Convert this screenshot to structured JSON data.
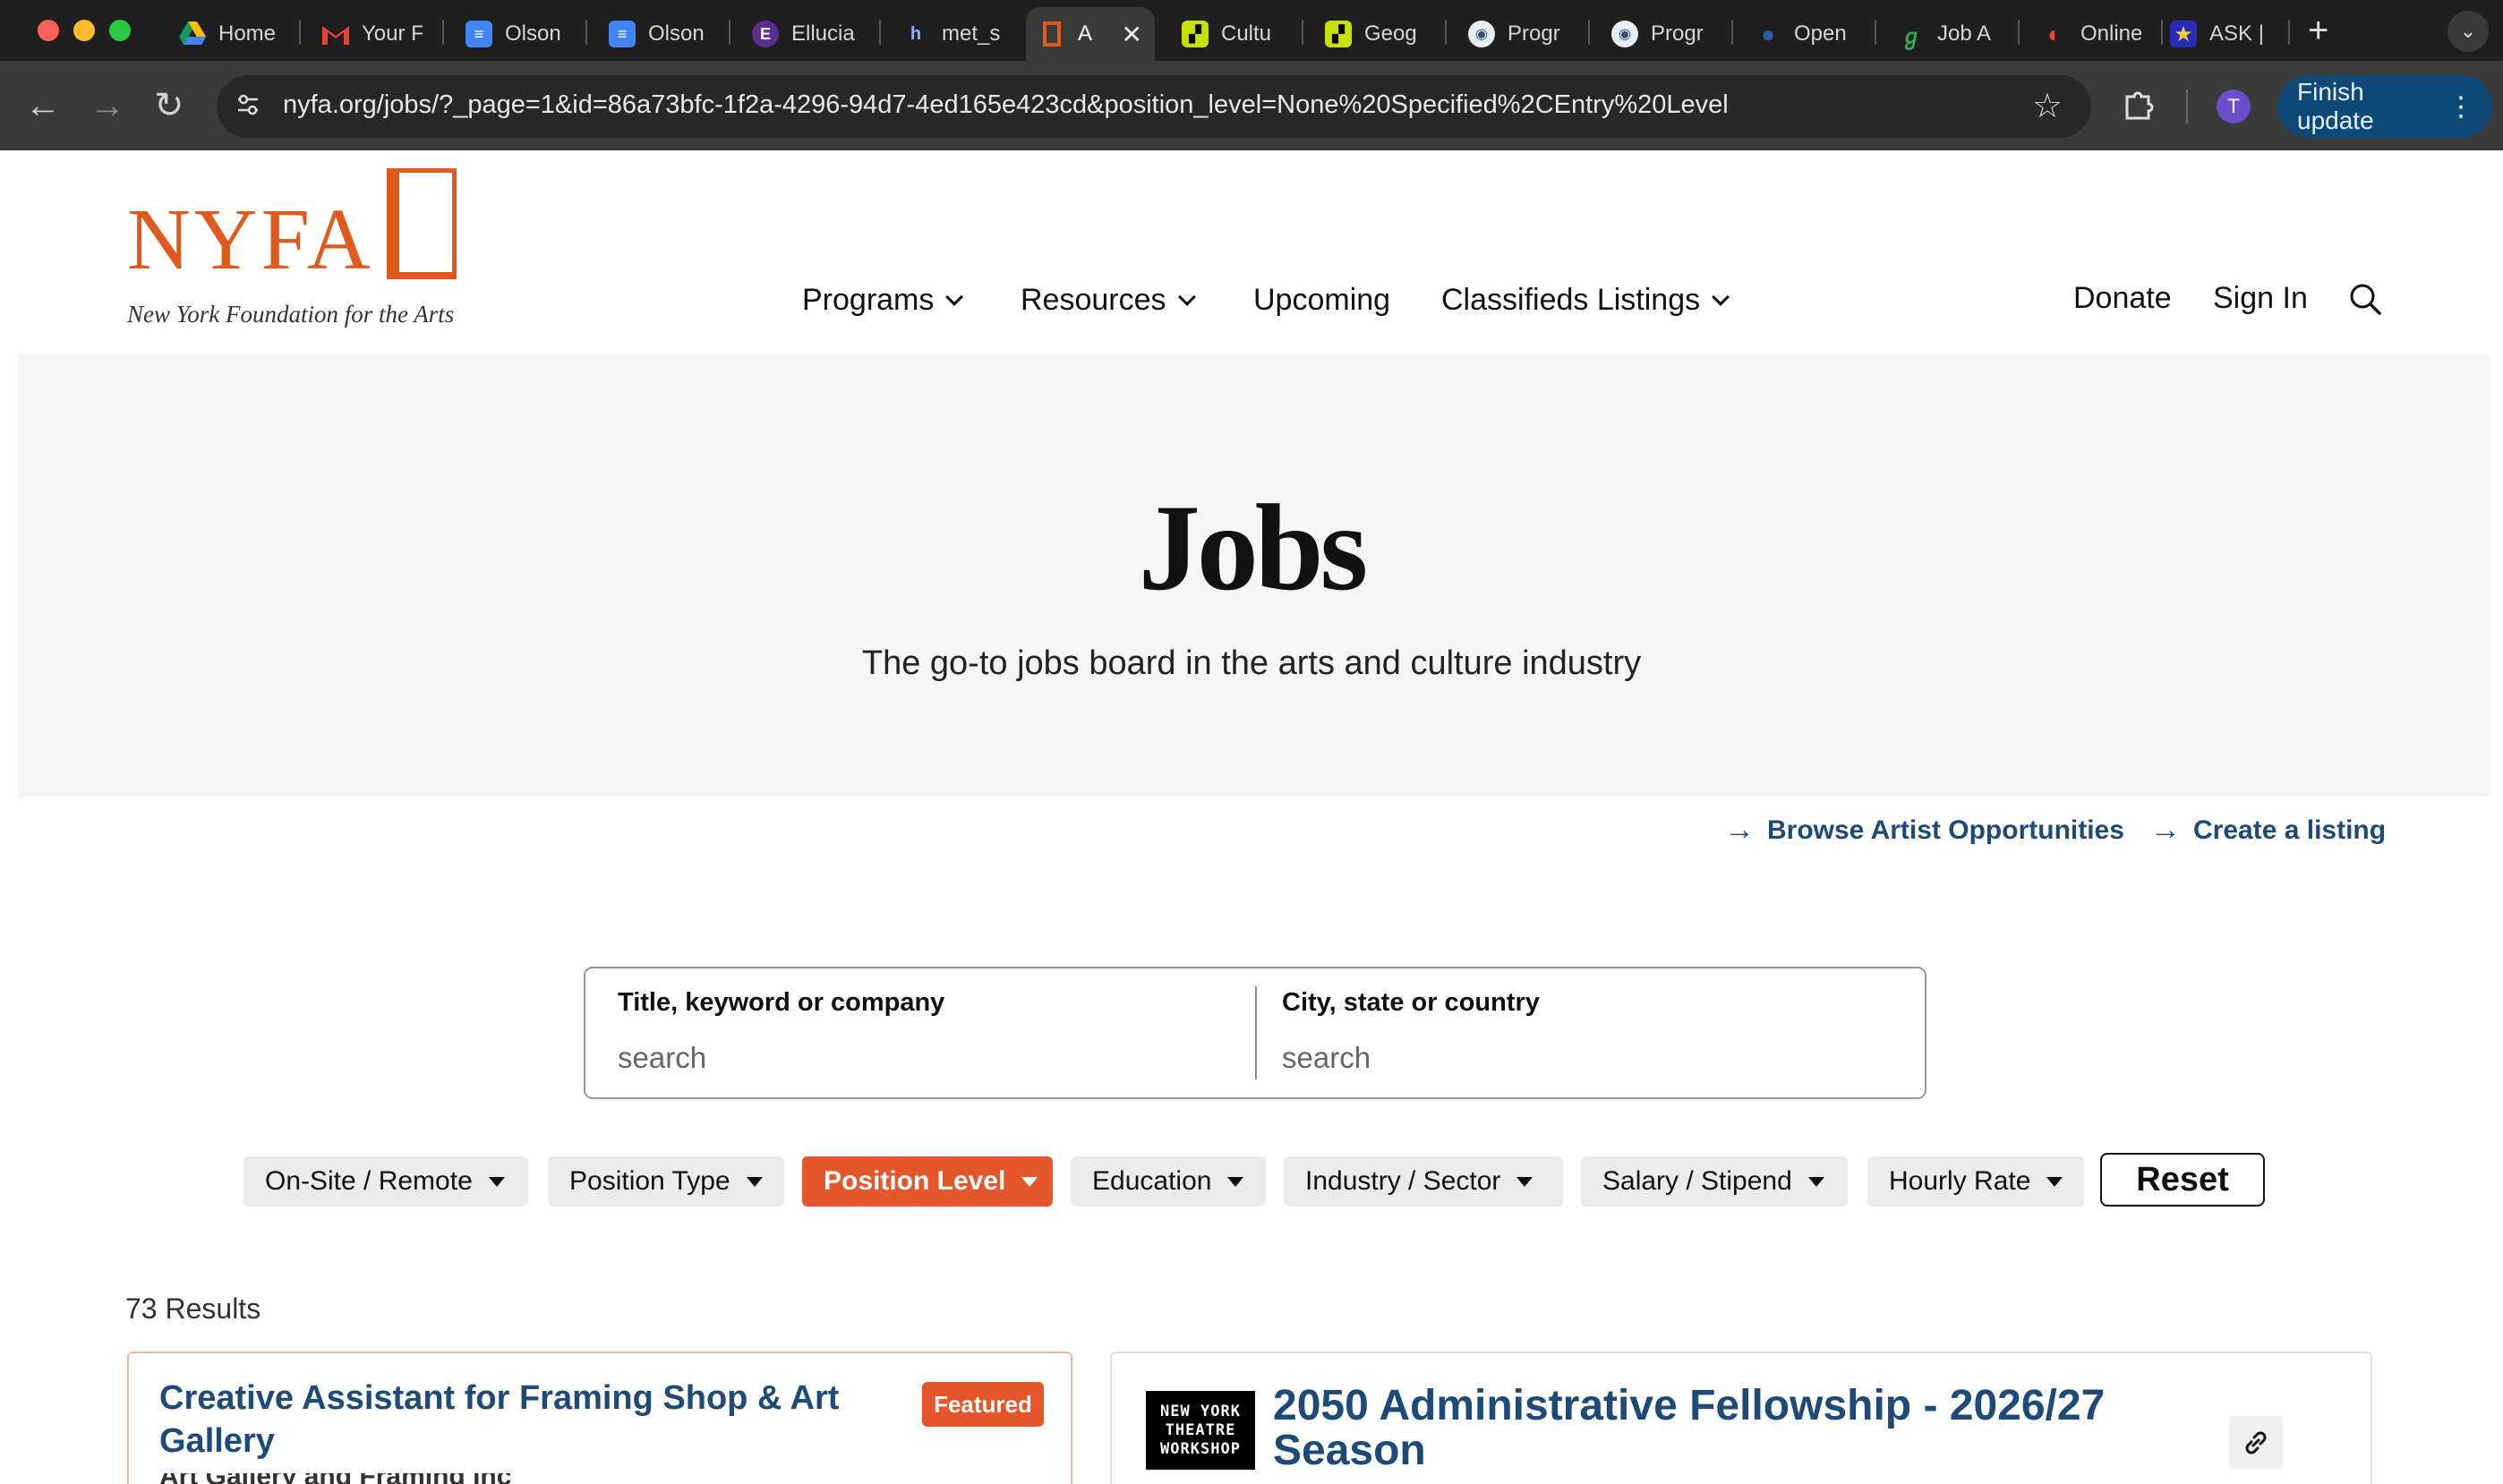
{
  "browser": {
    "tabs": [
      {
        "label": "Home",
        "icon": "google-drive-icon",
        "color": "#34a853",
        "active": false
      },
      {
        "label": "Your F",
        "icon": "gmail-icon",
        "color": "#ea4335",
        "active": false
      },
      {
        "label": "Olson",
        "icon": "google-docs-icon",
        "color": "#4285f4",
        "active": false
      },
      {
        "label": "Olson",
        "icon": "google-docs-icon",
        "color": "#4285f4",
        "active": false
      },
      {
        "label": "Ellucia",
        "icon": "ellucian-icon",
        "color": "#5b2d90",
        "active": false
      },
      {
        "label": "met_s",
        "icon": "h-icon",
        "color": "#1f1f1f",
        "active": false
      },
      {
        "label": "A",
        "icon": "nyfa-icon",
        "color": "#e05a1e",
        "active": true
      },
      {
        "label": "Cultu",
        "icon": "culture-icon",
        "color": "#c8e000",
        "active": false
      },
      {
        "label": "Geog",
        "icon": "geography-icon",
        "color": "#c8e000",
        "active": false
      },
      {
        "label": "Progr",
        "icon": "program-icon",
        "color": "#7a8ca8",
        "active": false
      },
      {
        "label": "Progr",
        "icon": "program-icon",
        "color": "#7a8ca8",
        "active": false
      },
      {
        "label": "Open",
        "icon": "open-icon",
        "color": "#2b5ea7",
        "active": false
      },
      {
        "label": "Job A",
        "icon": "job-icon",
        "color": "#34a853",
        "active": false
      },
      {
        "label": "Online",
        "icon": "online-icon",
        "color": "#e04e2c",
        "active": false
      },
      {
        "label": "ASK |",
        "icon": "star-icon",
        "color": "#f4d03f",
        "active": false
      }
    ],
    "new_tab": "+",
    "url": "nyfa.org/jobs/?_page=1&id=86a73bfc-1f2a-4296-94d7-4ed165e423cd&position_level=None%20Specified%2CEntry%20Level",
    "profile_initial": "T",
    "update_label": "Finish update"
  },
  "site": {
    "logo_text": "NYFA",
    "logo_tagline": "New York Foundation for the Arts",
    "nav": [
      {
        "label": "Programs",
        "dropdown": true
      },
      {
        "label": "Resources",
        "dropdown": true
      },
      {
        "label": "Upcoming",
        "dropdown": false
      },
      {
        "label": "Classifieds Listings",
        "dropdown": true
      }
    ],
    "donate": "Donate",
    "sign_in": "Sign In",
    "accent": "#e05a1e",
    "link_color": "#1e4a78"
  },
  "hero": {
    "title": "Jobs",
    "subtitle": "The go-to jobs board in the arts and culture industry"
  },
  "links": {
    "browse": "Browse Artist Opportunities",
    "create": "Create a listing"
  },
  "search": {
    "keyword_label": "Title, keyword or company",
    "keyword_placeholder": "search",
    "location_label": "City, state or country",
    "location_placeholder": "search"
  },
  "filters": [
    {
      "label": "On-Site / Remote",
      "active": false
    },
    {
      "label": "Position Type",
      "active": false
    },
    {
      "label": "Position Level",
      "active": true
    },
    {
      "label": "Education",
      "active": false
    },
    {
      "label": "Industry / Sector",
      "active": false
    },
    {
      "label": "Salary / Stipend",
      "active": false
    },
    {
      "label": "Hourly Rate",
      "active": false
    }
  ],
  "reset_label": "Reset",
  "results": {
    "count": "73 Results",
    "cards": [
      {
        "title_line1": "Creative Assistant for Framing Shop & Art",
        "title_line2": "Gallery",
        "badge": "Featured",
        "subtitle_partial": "Art Gallery and Framing Inc"
      },
      {
        "title_line1": "2050 Administrative Fellowship - 2026/27",
        "title_line2": "Season",
        "org_logo": [
          "NEW YORK",
          "THEATRE",
          "WORKSHOP"
        ]
      }
    ]
  }
}
